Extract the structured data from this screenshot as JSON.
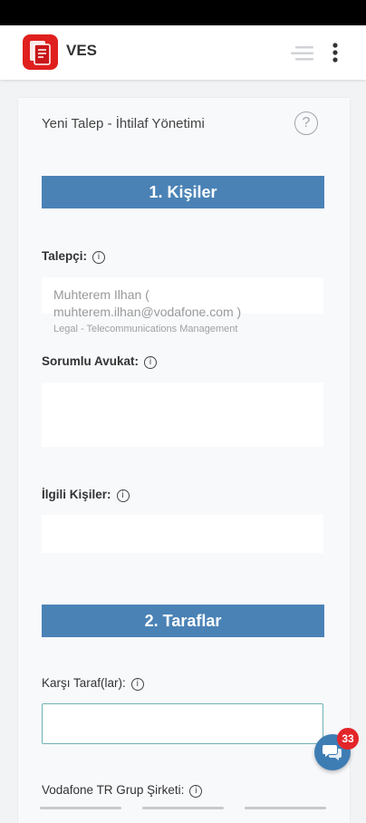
{
  "app": {
    "title": "VES"
  },
  "form": {
    "title": "Yeni Talep - İhtilaf Yönetimi",
    "help_glyph": "?"
  },
  "sections": {
    "kisiler": "1. Kişiler",
    "taraflar": "2. Taraflar"
  },
  "fields": {
    "talepci": {
      "label": "Talepçi:",
      "value": "Muhterem Ilhan ( muhterem.ilhan@vodafone.com )",
      "department": "Legal - Telecommunications Management"
    },
    "sorumlu_avukat": {
      "label": "Sorumlu Avukat:"
    },
    "ilgili_kisiler": {
      "label": "İlgili Kişiler:"
    },
    "karsi_taraf": {
      "label": "Karşı Taraf(lar):"
    },
    "grup_sirketi": {
      "label": "Vodafone TR Grup Şirketi:"
    }
  },
  "info_glyph": "i",
  "chat": {
    "badge_count": "33"
  },
  "colors": {
    "section_bar": "#4a82b6",
    "brand_red": "#e0201e",
    "focus_border": "#6fb1b5",
    "badge": "#e3262a",
    "chat_fab": "#3d7db3"
  }
}
